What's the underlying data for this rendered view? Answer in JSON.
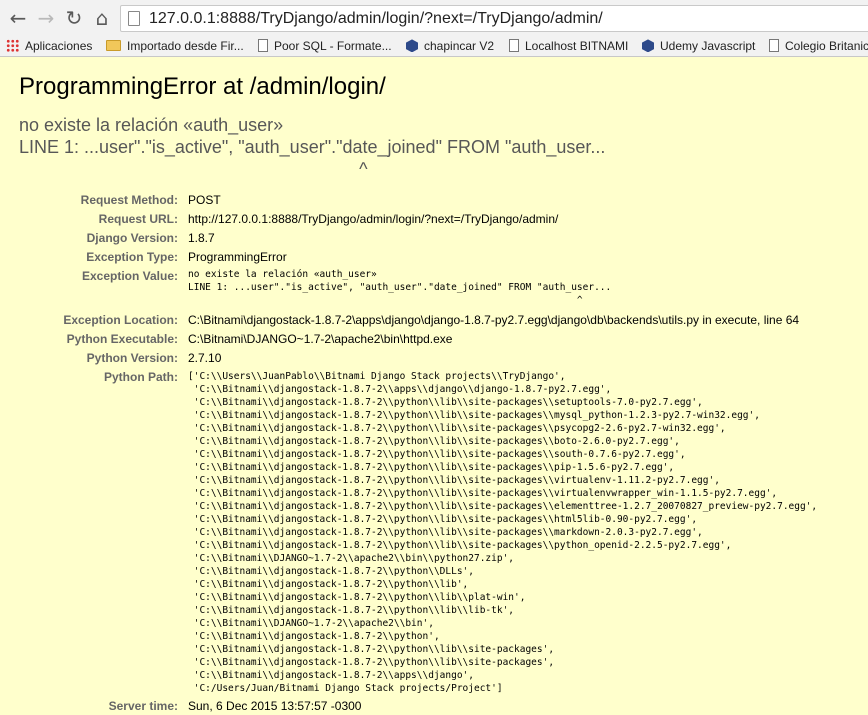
{
  "browser": {
    "url": "127.0.0.1:8888/TryDjango/admin/login/?next=/TryDjango/admin/",
    "nav": {
      "back_icon": "←",
      "forward_icon": "→",
      "reload_icon": "↻",
      "home_icon": "⌂"
    },
    "bookmarks": [
      {
        "label": "Aplicaciones",
        "icon": "apps-icon"
      },
      {
        "label": "Importado desde Fir...",
        "icon": "folder-icon"
      },
      {
        "label": "Poor SQL - Formate...",
        "icon": "page-icon"
      },
      {
        "label": "chapincar V2",
        "icon": "hex-icon"
      },
      {
        "label": "Localhost BITNAMI",
        "icon": "page-icon"
      },
      {
        "label": "Udemy Javascript",
        "icon": "hex-icon"
      },
      {
        "label": "Colegio Britanic",
        "icon": "page-icon"
      }
    ]
  },
  "error": {
    "title": "ProgrammingError at /admin/login/",
    "value": "no existe la relación «auth_user»\nLINE 1: ...user\".\"is_active\", \"auth_user\".\"date_joined\" FROM \"auth_user...\n                                                                    ^",
    "meta": {
      "request_method": {
        "label": "Request Method:",
        "value": "POST"
      },
      "request_url": {
        "label": "Request URL:",
        "value": "http://127.0.0.1:8888/TryDjango/admin/login/?next=/TryDjango/admin/"
      },
      "django_version": {
        "label": "Django Version:",
        "value": "1.8.7"
      },
      "exception_type": {
        "label": "Exception Type:",
        "value": "ProgrammingError"
      },
      "exception_value": {
        "label": "Exception Value:",
        "value": "no existe la relación «auth_user»\nLINE 1: ...user\".\"is_active\", \"auth_user\".\"date_joined\" FROM \"auth_user...\n                                                                    ^"
      },
      "exception_location": {
        "label": "Exception Location:",
        "value": "C:\\Bitnami\\djangostack-1.8.7-2\\apps\\django\\django-1.8.7-py2.7.egg\\django\\db\\backends\\utils.py in execute, line 64"
      },
      "python_executable": {
        "label": "Python Executable:",
        "value": "C:\\Bitnami\\DJANGO~1.7-2\\apache2\\bin\\httpd.exe"
      },
      "python_version": {
        "label": "Python Version:",
        "value": "2.7.10"
      },
      "python_path": {
        "label": "Python Path:",
        "value": "['C:\\\\Users\\\\JuanPablo\\\\Bitnami Django Stack projects\\\\TryDjango',\n 'C:\\\\Bitnami\\\\djangostack-1.8.7-2\\\\apps\\\\django\\\\django-1.8.7-py2.7.egg',\n 'C:\\\\Bitnami\\\\djangostack-1.8.7-2\\\\python\\\\lib\\\\site-packages\\\\setuptools-7.0-py2.7.egg',\n 'C:\\\\Bitnami\\\\djangostack-1.8.7-2\\\\python\\\\lib\\\\site-packages\\\\mysql_python-1.2.3-py2.7-win32.egg',\n 'C:\\\\Bitnami\\\\djangostack-1.8.7-2\\\\python\\\\lib\\\\site-packages\\\\psycopg2-2.6-py2.7-win32.egg',\n 'C:\\\\Bitnami\\\\djangostack-1.8.7-2\\\\python\\\\lib\\\\site-packages\\\\boto-2.6.0-py2.7.egg',\n 'C:\\\\Bitnami\\\\djangostack-1.8.7-2\\\\python\\\\lib\\\\site-packages\\\\south-0.7.6-py2.7.egg',\n 'C:\\\\Bitnami\\\\djangostack-1.8.7-2\\\\python\\\\lib\\\\site-packages\\\\pip-1.5.6-py2.7.egg',\n 'C:\\\\Bitnami\\\\djangostack-1.8.7-2\\\\python\\\\lib\\\\site-packages\\\\virtualenv-1.11.2-py2.7.egg',\n 'C:\\\\Bitnami\\\\djangostack-1.8.7-2\\\\python\\\\lib\\\\site-packages\\\\virtualenvwrapper_win-1.1.5-py2.7.egg',\n 'C:\\\\Bitnami\\\\djangostack-1.8.7-2\\\\python\\\\lib\\\\site-packages\\\\elementtree-1.2.7_20070827_preview-py2.7.egg',\n 'C:\\\\Bitnami\\\\djangostack-1.8.7-2\\\\python\\\\lib\\\\site-packages\\\\html5lib-0.90-py2.7.egg',\n 'C:\\\\Bitnami\\\\djangostack-1.8.7-2\\\\python\\\\lib\\\\site-packages\\\\markdown-2.0.3-py2.7.egg',\n 'C:\\\\Bitnami\\\\djangostack-1.8.7-2\\\\python\\\\lib\\\\site-packages\\\\python_openid-2.2.5-py2.7.egg',\n 'C:\\\\Bitnami\\\\DJANGO~1.7-2\\\\apache2\\\\bin\\\\python27.zip',\n 'C:\\\\Bitnami\\\\djangostack-1.8.7-2\\\\python\\\\DLLs',\n 'C:\\\\Bitnami\\\\djangostack-1.8.7-2\\\\python\\\\lib',\n 'C:\\\\Bitnami\\\\djangostack-1.8.7-2\\\\python\\\\lib\\\\plat-win',\n 'C:\\\\Bitnami\\\\djangostack-1.8.7-2\\\\python\\\\lib\\\\lib-tk',\n 'C:\\\\Bitnami\\\\DJANGO~1.7-2\\\\apache2\\\\bin',\n 'C:\\\\Bitnami\\\\djangostack-1.8.7-2\\\\python',\n 'C:\\\\Bitnami\\\\djangostack-1.8.7-2\\\\python\\\\lib\\\\site-packages',\n 'C:\\\\Bitnami\\\\djangostack-1.8.7-2\\\\python\\\\lib\\\\site-packages',\n 'C:\\\\Bitnami\\\\djangostack-1.8.7-2\\\\apps\\\\django',\n 'C:/Users/Juan/Bitnami Django Stack projects/Project']"
      },
      "server_time": {
        "label": "Server time:",
        "value": "Sun, 6 Dec 2015 13:57:57 -0300"
      }
    }
  },
  "colors": {
    "background": "#ffffcc",
    "label": "#666666",
    "subtitle": "#575757"
  }
}
